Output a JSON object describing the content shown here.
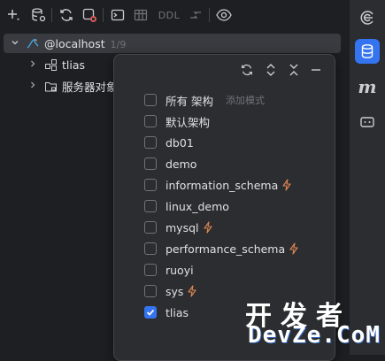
{
  "toolbar": {
    "items": [
      {
        "name": "add-icon"
      },
      {
        "name": "data-source-properties-icon"
      },
      {
        "name": "refresh-icon"
      },
      {
        "name": "stop-icon"
      },
      {
        "name": "open-console-icon"
      },
      {
        "name": "table-icon"
      },
      {
        "name": "ddl-icon",
        "label": "DDL"
      },
      {
        "name": "jump-icon"
      },
      {
        "name": "view-options-icon"
      }
    ]
  },
  "tree": {
    "root": {
      "label": "@localhost",
      "badge": "1/9"
    },
    "children": [
      {
        "label": "tlias",
        "icon": "schema-icon"
      },
      {
        "label": "服务器对象",
        "icon": "folder-icon"
      }
    ]
  },
  "popup": {
    "all_schemas_label": "所有 架构",
    "add_mode_label": "添加模式",
    "schemas": [
      {
        "label": "默认架构",
        "checked": false,
        "bolt": false
      },
      {
        "label": "db01",
        "checked": false,
        "bolt": false
      },
      {
        "label": "demo",
        "checked": false,
        "bolt": false
      },
      {
        "label": "information_schema",
        "checked": false,
        "bolt": true
      },
      {
        "label": "linux_demo",
        "checked": false,
        "bolt": false
      },
      {
        "label": "mysql",
        "checked": false,
        "bolt": true
      },
      {
        "label": "performance_schema",
        "checked": false,
        "bolt": true
      },
      {
        "label": "ruoyi",
        "checked": false,
        "bolt": false
      },
      {
        "label": "sys",
        "checked": false,
        "bolt": true
      },
      {
        "label": "tlias",
        "checked": true,
        "bolt": false
      }
    ]
  },
  "right_strip": {
    "items": [
      {
        "name": "ai-assistant-icon",
        "active": false
      },
      {
        "name": "database-icon",
        "active": true
      },
      {
        "name": "maven-icon",
        "label": "m",
        "active": false
      },
      {
        "name": "terminal-icon",
        "active": false
      }
    ]
  },
  "watermark": {
    "line1": "开发者",
    "line2": "DevZe.CoM"
  },
  "colors": {
    "accent": "#3574f0",
    "bolt": "#e08855",
    "bg": "#1e1f22",
    "panel": "#2b2d30"
  }
}
